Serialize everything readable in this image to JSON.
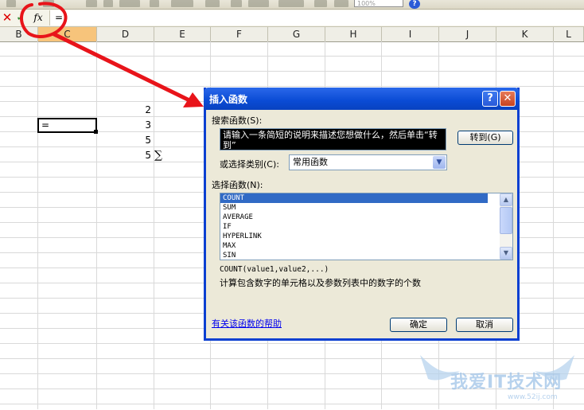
{
  "formula_bar": {
    "fx_label": "fx",
    "content": "=",
    "cancel_icon": "cancel-icon",
    "enter_icon": "enter-icon"
  },
  "toolbar": {
    "zoom": "100%",
    "help_label": "?"
  },
  "columns": [
    "B",
    "C",
    "D",
    "E",
    "F",
    "G",
    "H",
    "I",
    "J",
    "K",
    "L"
  ],
  "sheet": {
    "active_cell_content": "=",
    "values": [
      "2",
      "3",
      "5",
      "5"
    ],
    "sigma": "∑"
  },
  "dialog": {
    "title": "插入函数",
    "help_label": "?",
    "close_label": "✕",
    "search_label": "搜索函数(S):",
    "search_text": "请输入一条简短的说明来描述您想做什么，然后单击“转到”",
    "goto_button": "转到(G)",
    "category_label": "或选择类别(C):",
    "category_value": "常用函数",
    "function_list_label": "选择函数(N):",
    "functions": [
      "COUNT",
      "SUM",
      "AVERAGE",
      "IF",
      "HYPERLINK",
      "MAX",
      "SIN"
    ],
    "selected_function": "COUNT",
    "syntax": "COUNT(value1,value2,...)",
    "description": "计算包含数字的单元格以及参数列表中的数字的个数",
    "help_link": "有关该函数的帮助",
    "ok_button": "确定",
    "cancel_button": "取消"
  },
  "watermark": {
    "text": "我爱IT技术网",
    "url": "www.52ij.com"
  },
  "colors": {
    "title_bar": "#0a4bd4",
    "selection": "#316ac5",
    "annotation": "#e8141a"
  }
}
